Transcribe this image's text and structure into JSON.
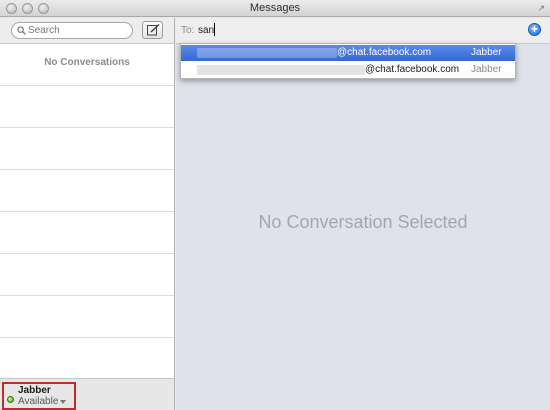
{
  "window": {
    "title": "Messages"
  },
  "sidebar": {
    "search_placeholder": "Search",
    "empty_text": "No Conversations",
    "account": {
      "name": "Jabber",
      "status": "Available"
    }
  },
  "compose": {
    "to_label": "To:",
    "to_value": "san"
  },
  "main": {
    "empty_text": "No Conversation Selected"
  },
  "suggestions": [
    {
      "email": "@chat.facebook.com",
      "service": "Jabber",
      "selected": true
    },
    {
      "email": "@chat.facebook.com",
      "service": "Jabber",
      "selected": false
    }
  ],
  "colors": {
    "selection": "#3569d4",
    "account_highlight": "#c42a2a",
    "status_available": "#52a016",
    "add_button": "#1f6ad8"
  },
  "icons": [
    "search-icon",
    "compose-icon",
    "add-recipient-icon",
    "status-available-icon",
    "chevron-down-icon",
    "fullscreen-icon"
  ]
}
